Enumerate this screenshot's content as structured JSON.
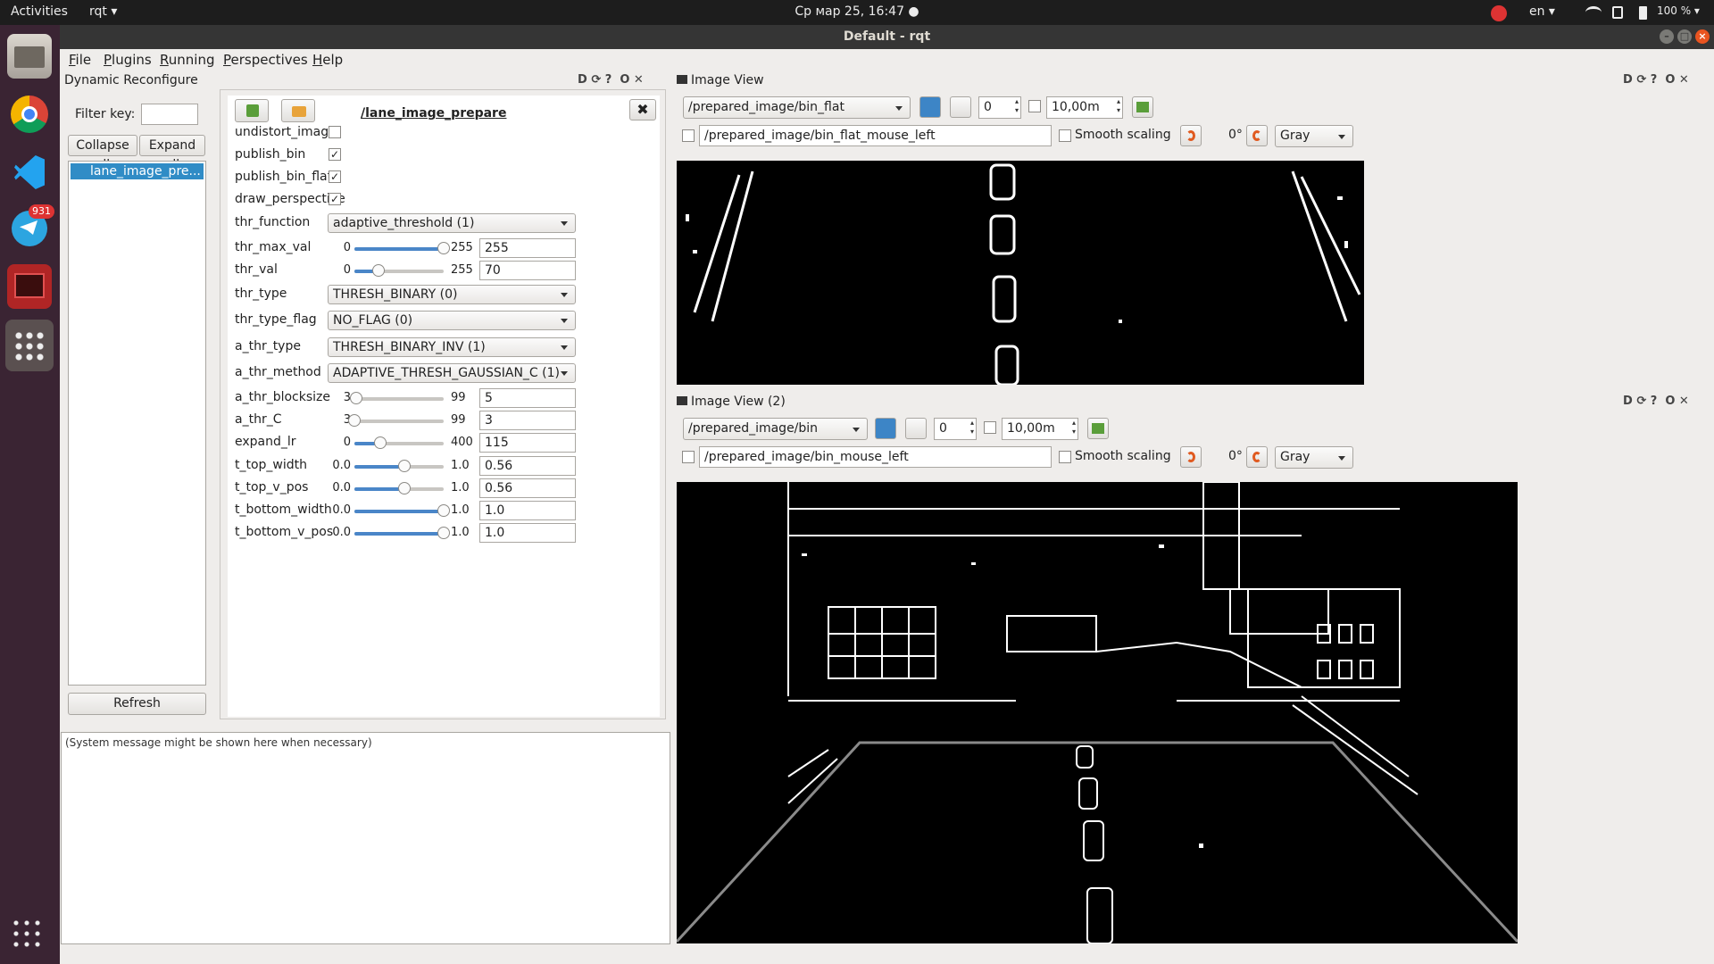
{
  "topbar": {
    "activities": "Activities",
    "app": "rqt ▾",
    "clock": "Ср мар 25, 16:47 ●",
    "lang": "en ▾",
    "battery": "100 % ▾"
  },
  "dock": {
    "telegram_badge": "931",
    "tray_badge": "931"
  },
  "window": {
    "title": "Default - rqt"
  },
  "menu": [
    "File",
    "Plugins",
    "Running",
    "Perspectives",
    "Help"
  ],
  "dynrec": {
    "title": "Dynamic Reconfigure",
    "filter_label": "Filter key:",
    "filter_value": "",
    "collapse": "Collapse all",
    "expand": "Expand all",
    "tree_item": "lane_image_pre...",
    "refresh": "Refresh",
    "node_name": "/lane_image_prepare",
    "params": [
      {
        "name": "undistort_image",
        "kind": "bool",
        "checked": false
      },
      {
        "name": "publish_bin",
        "kind": "bool",
        "checked": true
      },
      {
        "name": "publish_bin_flat",
        "kind": "bool",
        "checked": true
      },
      {
        "name": "draw_perspective",
        "kind": "bool",
        "checked": true
      },
      {
        "name": "thr_function",
        "kind": "enum",
        "value": "adaptive_threshold (1)"
      },
      {
        "name": "thr_max_val",
        "kind": "slider",
        "min": "0",
        "max": "255",
        "value": "255",
        "frac": 1.0
      },
      {
        "name": "thr_val",
        "kind": "slider",
        "min": "0",
        "max": "255",
        "value": "70",
        "frac": 0.27
      },
      {
        "name": "thr_type",
        "kind": "enum",
        "value": "THRESH_BINARY (0)"
      },
      {
        "name": "thr_type_flag",
        "kind": "enum",
        "value": "NO_FLAG (0)"
      },
      {
        "name": "a_thr_type",
        "kind": "enum",
        "value": "THRESH_BINARY_INV (1)"
      },
      {
        "name": "a_thr_method",
        "kind": "enum",
        "value": "ADAPTIVE_THRESH_GAUSSIAN_C (1)"
      },
      {
        "name": "a_thr_blocksize",
        "kind": "slider",
        "min": "3",
        "max": "99",
        "value": "5",
        "frac": 0.02
      },
      {
        "name": "a_thr_C",
        "kind": "slider",
        "min": "3",
        "max": "99",
        "value": "3",
        "frac": 0.0
      },
      {
        "name": "expand_lr",
        "kind": "slider",
        "min": "0",
        "max": "400",
        "value": "115",
        "frac": 0.29
      },
      {
        "name": "t_top_width",
        "kind": "slider",
        "min": "0.0",
        "max": "1.0",
        "value": "0.56",
        "frac": 0.56
      },
      {
        "name": "t_top_v_pos",
        "kind": "slider",
        "min": "0.0",
        "max": "1.0",
        "value": "0.56",
        "frac": 0.56
      },
      {
        "name": "t_bottom_width",
        "kind": "slider",
        "min": "0.0",
        "max": "1.0",
        "value": "1.0",
        "frac": 1.0
      },
      {
        "name": "t_bottom_v_pos",
        "kind": "slider",
        "min": "0.0",
        "max": "1.0",
        "value": "1.0",
        "frac": 1.0
      }
    ]
  },
  "console": {
    "message": "(System message might be shown here when necessary)"
  },
  "panel_ctl": "D",
  "image_view_1": {
    "title": "Image View",
    "topic": "/prepared_image/bin_flat",
    "spin_value": "0",
    "time_value": "10,00m",
    "mouse_topic": "/prepared_image/bin_flat_mouse_left",
    "smooth": "Smooth scaling",
    "rotation": "0°",
    "colormap": "Gray"
  },
  "image_view_2": {
    "title": "Image View (2)",
    "topic": "/prepared_image/bin",
    "spin_value": "0",
    "time_value": "10,00m",
    "mouse_topic": "/prepared_image/bin_mouse_left",
    "smooth": "Smooth scaling",
    "rotation": "0°",
    "colormap": "Gray"
  }
}
